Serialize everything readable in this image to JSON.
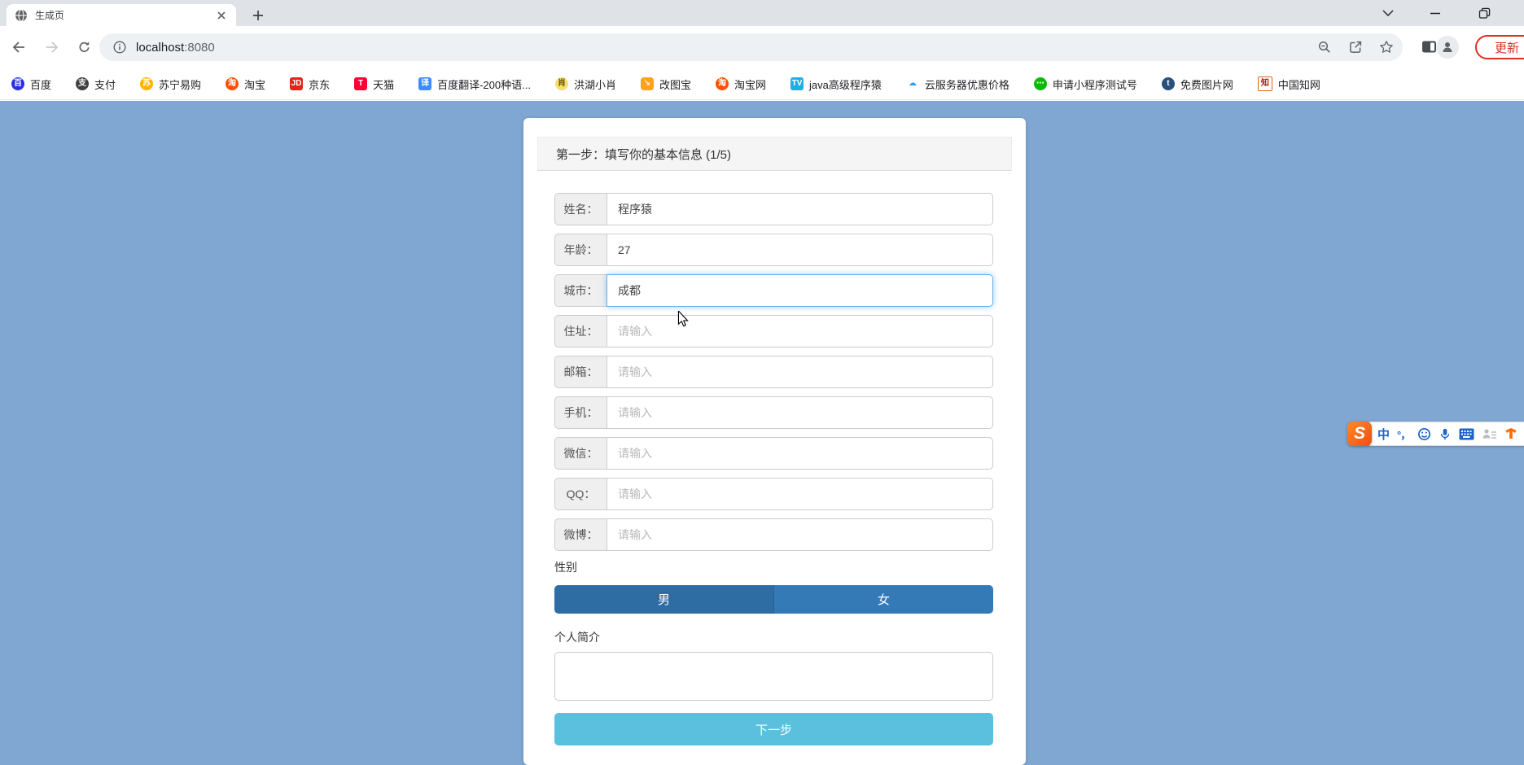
{
  "browser": {
    "tab_title": "生成页",
    "url_host": "localhost",
    "url_port": ":8080",
    "update_label": "更新"
  },
  "bookmarks": [
    {
      "label": "百度",
      "icon": {
        "glyph": "百",
        "bg": "#2932e1",
        "fg": "#ffffff",
        "radius": "50%",
        "border": "none"
      }
    },
    {
      "label": "支付",
      "icon": {
        "glyph": "支",
        "bg": "#3f4043",
        "fg": "#ffffff",
        "radius": "50%",
        "border": "none"
      }
    },
    {
      "label": "苏宁易购",
      "icon": {
        "glyph": "苏",
        "bg": "#ffb300",
        "fg": "#ffffff",
        "radius": "50%",
        "border": "none"
      }
    },
    {
      "label": "淘宝",
      "icon": {
        "glyph": "淘",
        "bg": "#ff5000",
        "fg": "#ffffff",
        "radius": "50%",
        "border": "none"
      }
    },
    {
      "label": "京东",
      "icon": {
        "glyph": "JD",
        "bg": "#e1251b",
        "fg": "#ffffff",
        "radius": "3px",
        "border": "none"
      }
    },
    {
      "label": "天猫",
      "icon": {
        "glyph": "T",
        "bg": "#ff0036",
        "fg": "#ffffff",
        "radius": "3px",
        "border": "none"
      }
    },
    {
      "label": "百度翻译-200种语...",
      "icon": {
        "glyph": "译",
        "bg": "#3c8cff",
        "fg": "#ffffff",
        "radius": "3px",
        "border": "none"
      }
    },
    {
      "label": "洪湖小肖",
      "icon": {
        "glyph": "肖",
        "bg": "#f5df6f",
        "fg": "#6b5200",
        "radius": "50%",
        "border": "none"
      }
    },
    {
      "label": "改图宝",
      "icon": {
        "glyph": "↘",
        "bg": "#ffa21d",
        "fg": "#ffffff",
        "radius": "4px",
        "border": "none"
      }
    },
    {
      "label": "淘宝网",
      "icon": {
        "glyph": "淘",
        "bg": "#ff5000",
        "fg": "#ffffff",
        "radius": "50%",
        "border": "none"
      }
    },
    {
      "label": "java高级程序猿",
      "icon": {
        "glyph": "TV",
        "bg": "#23ade5",
        "fg": "#ffffff",
        "radius": "3px",
        "border": "none"
      }
    },
    {
      "label": "云服务器优惠价格",
      "icon": {
        "glyph": "☁",
        "bg": "transparent",
        "fg": "#2b9df4",
        "radius": "0",
        "border": "none"
      }
    },
    {
      "label": "申请小程序测试号",
      "icon": {
        "glyph": "⋯",
        "bg": "#09bb07",
        "fg": "#ffffff",
        "radius": "50%",
        "border": "none"
      }
    },
    {
      "label": "免费图片网",
      "icon": {
        "glyph": "t",
        "bg": "#29527a",
        "fg": "#ffffff",
        "radius": "50%",
        "border": "none"
      }
    },
    {
      "label": "中国知网",
      "icon": {
        "glyph": "知",
        "bg": "#ffffff",
        "fg": "#a01d10",
        "radius": "2px",
        "border": "1px solid #e8630c"
      }
    }
  ],
  "form": {
    "title": "第一步：填写你的基本信息 (1/5)",
    "fields": [
      {
        "label": "姓名：",
        "value": "程序猿"
      },
      {
        "label": "年龄：",
        "value": "27"
      },
      {
        "label": "城市：",
        "value": "成都",
        "focused": true
      },
      {
        "label": "住址：",
        "placeholder": "请输入"
      },
      {
        "label": "邮箱：",
        "placeholder": "请输入"
      },
      {
        "label": "手机：",
        "placeholder": "请输入"
      },
      {
        "label": "微信：",
        "placeholder": "请输入"
      },
      {
        "label": "QQ：",
        "placeholder": "请输入"
      },
      {
        "label": "微博：",
        "placeholder": "请输入"
      }
    ],
    "gender": {
      "label": "性别",
      "options": [
        "男",
        "女"
      ]
    },
    "intro_label": "个人简介",
    "intro_value": "",
    "next_label": "下一步"
  },
  "ime": {
    "logo": "S",
    "mode": "中",
    "punct": "°，"
  },
  "colors": {
    "page_bg": "#7fa7d2",
    "focus_border": "#66afe9",
    "male_btn": "#2e6da4",
    "female_btn": "#337ab7",
    "next_btn": "#5bc0de",
    "update_red": "#d93025"
  }
}
